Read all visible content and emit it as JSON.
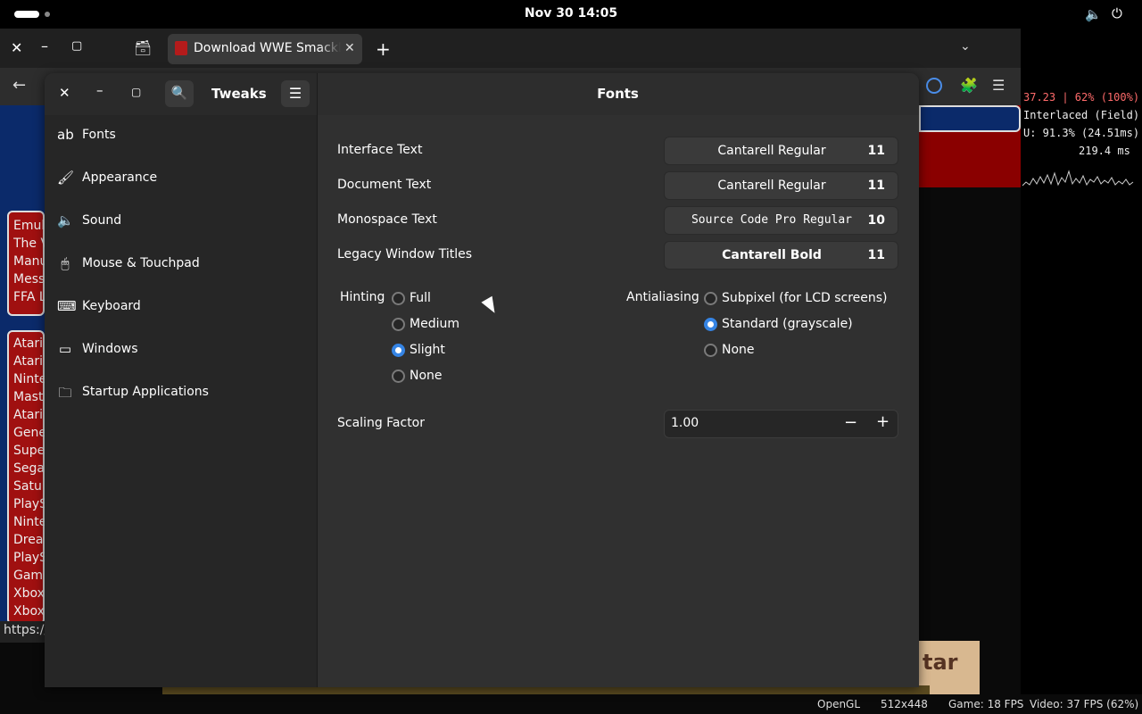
{
  "topbar": {
    "clock": "Nov 30  14:05",
    "volume_icon": "🔈",
    "power_icon": "⏻"
  },
  "browser": {
    "close_glyph": "✕",
    "min_glyph": "–",
    "max_glyph": "▢",
    "archive_glyph": "🗃",
    "tab_title": "Download WWE SmackDown",
    "tab_close_glyph": "✕",
    "newtab_glyph": "+",
    "dropdown_glyph": "⌄",
    "back_glyph": "←",
    "ext_glyph": "🧩",
    "menu_glyph": "☰",
    "status_url": "https://"
  },
  "page_items_top": [
    "Emul",
    "The V",
    "Manu",
    "Mess",
    "FFA L"
  ],
  "page_items_bottom": [
    "Atari",
    "Atari",
    "Ninte",
    "Mast",
    "Atari",
    "Gene",
    "Supe",
    "Sega",
    "Satu",
    "PlayS",
    "Ninte",
    "Drea",
    "PlayS",
    "Gam",
    "Xbox",
    "Xbox"
  ],
  "page_image_text": "tar",
  "overlay": {
    "line1": "37.23 | 62% (100%)",
    "line2": "Interlaced (Field)",
    "line3": "U: 91.3% (24.51ms)",
    "line4": "219.4 ms"
  },
  "bottombar": {
    "renderer": "OpenGL",
    "resolution": "512x448",
    "game_fps": "Game: 18 FPS",
    "video_fps": "Video: 37 FPS (62%)"
  },
  "tweaks": {
    "title": "Tweaks",
    "panel_title": "Fonts",
    "close_glyph": "✕",
    "min_glyph": "–",
    "max_glyph": "▢",
    "search_glyph": "🔍",
    "menu_glyph": "☰",
    "sidebar": [
      {
        "label": "Fonts",
        "icon": "ab",
        "active": true
      },
      {
        "label": "Appearance",
        "icon": "🖌",
        "active": false
      },
      {
        "label": "Sound",
        "icon": "🔈",
        "active": false
      },
      {
        "label": "Mouse & Touchpad",
        "icon": "🖱",
        "active": false
      },
      {
        "label": "Keyboard",
        "icon": "⌨",
        "active": false
      },
      {
        "label": "Windows",
        "icon": "▭",
        "active": false
      },
      {
        "label": "Startup Applications",
        "icon": "🗀",
        "active": false
      }
    ],
    "fonts": [
      {
        "label": "Interface Text",
        "font": "Cantarell Regular",
        "size": "11"
      },
      {
        "label": "Document Text",
        "font": "Cantarell Regular",
        "size": "11"
      },
      {
        "label": "Monospace Text",
        "font": "Source Code Pro Regular",
        "size": "10"
      },
      {
        "label": "Legacy Window Titles",
        "font": "Cantarell Bold",
        "size": "11"
      }
    ],
    "hinting": {
      "label": "Hinting",
      "options": [
        "Full",
        "Medium",
        "Slight",
        "None"
      ],
      "selected": "Slight"
    },
    "antialiasing": {
      "label": "Antialiasing",
      "options": [
        "Subpixel (for LCD screens)",
        "Standard (grayscale)",
        "None"
      ],
      "selected": "Standard (grayscale)"
    },
    "scaling": {
      "label": "Scaling Factor",
      "value": "1.00",
      "minus": "−",
      "plus": "+"
    }
  },
  "colors": {
    "accent": "#3584e4",
    "selected_row": "#1f5fb3",
    "page_red": "#a01010",
    "page_blue": "#0b2a6a"
  }
}
